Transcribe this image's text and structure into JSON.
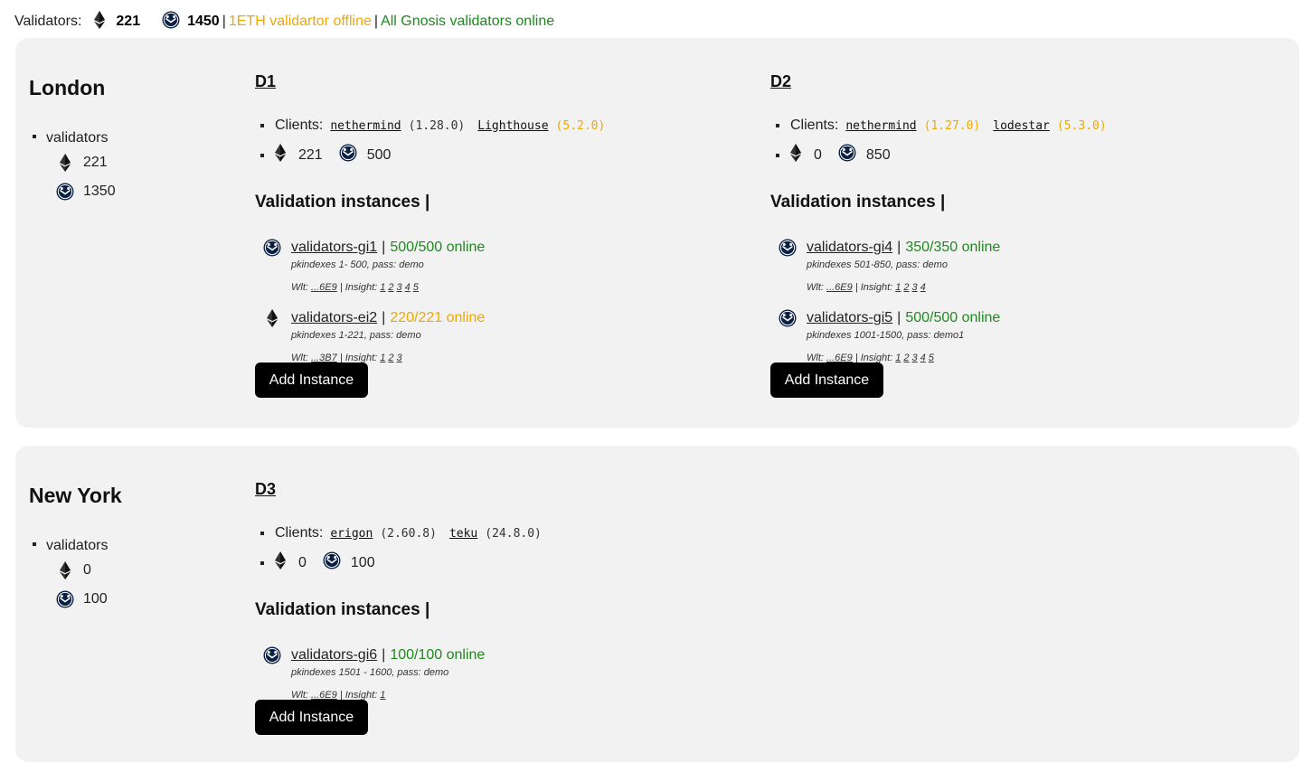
{
  "header": {
    "validators_label": "Validators:",
    "eth_count": "221",
    "gno_count": "1450",
    "sep1": "|",
    "eth_status": "1ETH validartor offline",
    "sep2": "|",
    "gno_status": "All Gnosis validators online"
  },
  "colors": {
    "warning": "#f0a800",
    "ok": "#1e8a1e",
    "panel": "#f2f2f2",
    "button": "#000000"
  },
  "icons": {
    "eth": "ethereum-icon",
    "gno": "gnosis-icon"
  },
  "regions": [
    {
      "name": "London",
      "validators_label": "validators",
      "eth": "221",
      "gno": "1350",
      "datacenters": [
        {
          "name": "D1",
          "clients_label": "Clients:",
          "el_client": "nethermind",
          "el_version": "(1.28.0)",
          "el_version_warn": false,
          "cl_client": "Lighthouse",
          "cl_version": "(5.2.0)",
          "cl_version_warn": true,
          "eth": "221",
          "gno": "500",
          "instances_title": "Validation instances |",
          "instances": [
            {
              "chain": "gno",
              "name": "validators-gi1",
              "sep": "|",
              "status": "500/500 online",
              "status_ok": true,
              "pkindexes": "pkindexes 1- 500, pass: demo",
              "wlt_label": "Wlt:",
              "wlt": "...6E9",
              "insight_label": "| Insight:",
              "insights": [
                "1",
                "2",
                "3",
                "4",
                "5"
              ]
            },
            {
              "chain": "eth",
              "name": "validators-ei2",
              "sep": "|",
              "status": "220/221 online",
              "status_ok": false,
              "pkindexes": "pkindexes 1-221, pass: demo",
              "wlt_label": "Wlt:",
              "wlt": "...3B7",
              "insight_label": "| Insight:",
              "insights": [
                "1",
                "2",
                "3"
              ]
            }
          ],
          "add_label": "Add Instance"
        },
        {
          "name": "D2",
          "clients_label": "Clients:",
          "el_client": "nethermind",
          "el_version": "(1.27.0)",
          "el_version_warn": true,
          "cl_client": "lodestar",
          "cl_version": "(5.3.0)",
          "cl_version_warn": true,
          "eth": "0",
          "gno": "850",
          "instances_title": "Validation instances |",
          "instances": [
            {
              "chain": "gno",
              "name": "validators-gi4",
              "sep": "|",
              "status": "350/350 online",
              "status_ok": true,
              "pkindexes": "pkindexes 501-850, pass: demo",
              "wlt_label": "Wlt:",
              "wlt": "...6E9",
              "insight_label": "| Insight:",
              "insights": [
                "1",
                "2",
                "3",
                "4"
              ]
            },
            {
              "chain": "gno",
              "name": "validators-gi5",
              "sep": "|",
              "status": "500/500 online",
              "status_ok": true,
              "pkindexes": "pkindexes 1001-1500, pass: demo1",
              "wlt_label": "Wlt:",
              "wlt": "...6E9",
              "insight_label": "| Insight:",
              "insights": [
                "1",
                "2",
                "3",
                "4",
                "5"
              ]
            }
          ],
          "add_label": "Add Instance"
        }
      ]
    },
    {
      "name": "New York",
      "validators_label": "validators",
      "eth": "0",
      "gno": "100",
      "datacenters": [
        {
          "name": "D3",
          "clients_label": "Clients:",
          "el_client": "erigon",
          "el_version": "(2.60.8)",
          "el_version_warn": false,
          "cl_client": "teku",
          "cl_version": "(24.8.0)",
          "cl_version_warn": false,
          "eth": "0",
          "gno": "100",
          "instances_title": "Validation instances |",
          "instances": [
            {
              "chain": "gno",
              "name": "validators-gi6",
              "sep": "|",
              "status": "100/100 online",
              "status_ok": true,
              "pkindexes": "pkindexes 1501 - 1600, pass: demo",
              "wlt_label": "Wlt:",
              "wlt": "...6E9",
              "insight_label": "| Insight:",
              "insights": [
                "1"
              ]
            }
          ],
          "add_label": "Add Instance"
        }
      ]
    }
  ]
}
